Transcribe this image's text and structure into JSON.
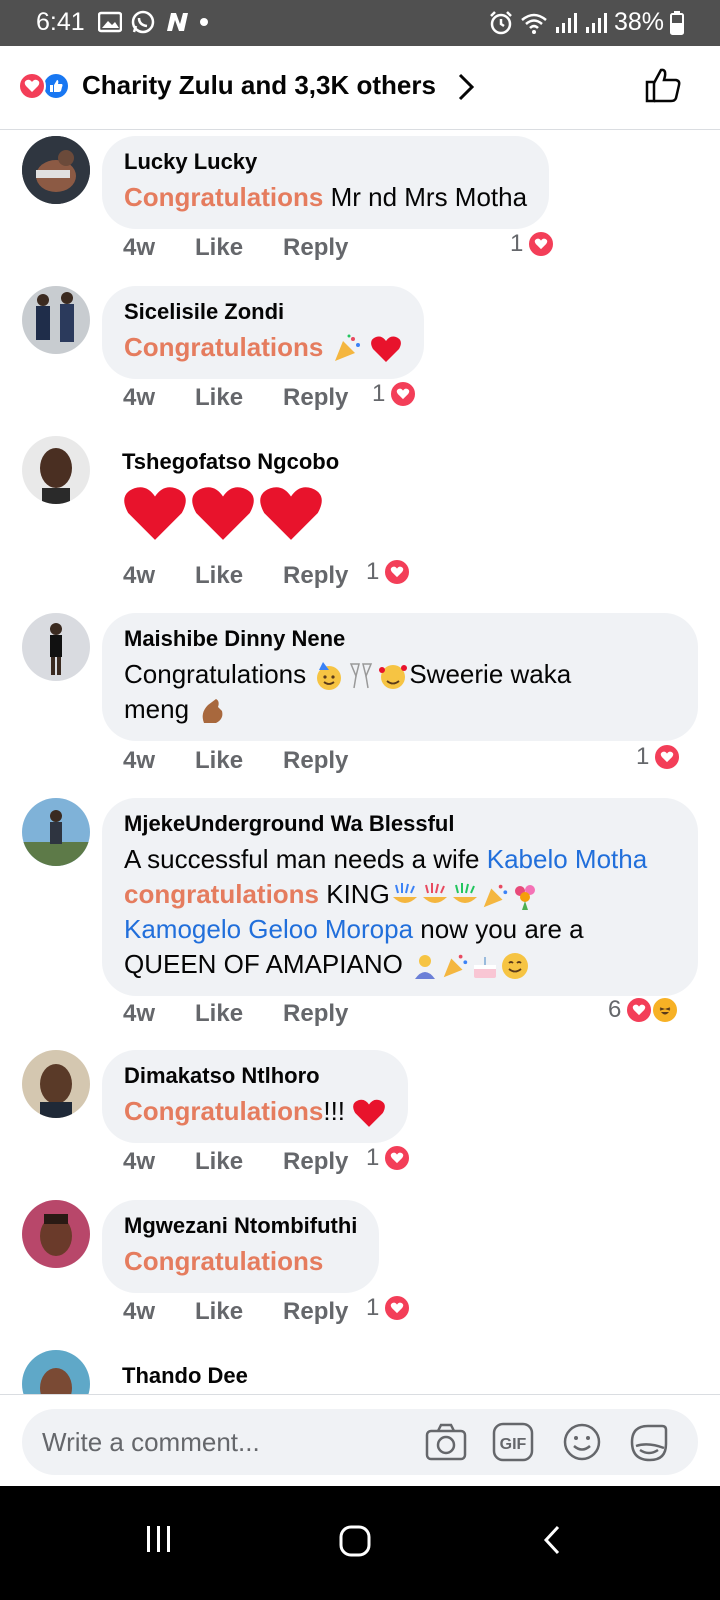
{
  "status_bar": {
    "time": "6:41",
    "battery": "38%"
  },
  "header": {
    "title": "Charity Zulu and 3,3K others"
  },
  "comments": [
    {
      "name": "Lucky Lucky",
      "keyword": "Congratulations",
      "text": " Mr nd Mrs Motha",
      "time": "4w",
      "like": "Like",
      "reply": "Reply",
      "reaction_count": "1"
    },
    {
      "name": "Sicelisile Zondi",
      "keyword": "Congratulations",
      "text": "",
      "time": "4w",
      "like": "Like",
      "reply": "Reply",
      "reaction_count": "1"
    },
    {
      "name": "Tshegofatso Ngcobo",
      "time": "4w",
      "like": "Like",
      "reply": "Reply",
      "reaction_count": "1"
    },
    {
      "name": "Maishibe Dinny Nene",
      "text_a": "Congratulations ",
      "text_b": "Sweerie waka",
      "text_c": "meng ",
      "time": "4w",
      "like": "Like",
      "reply": "Reply",
      "reaction_count": "1"
    },
    {
      "name": "MjekeUnderground Wa Blessful",
      "text_a": "A  successful man needs a wife ",
      "tag_1": "Kabelo Motha",
      "keyword": "congratulations",
      "text_b": " KING",
      "tag_2": "Kamogelo Geloo Moropa",
      "text_c": "  now you are a QUEEN OF AMAPIANO ",
      "time": "4w",
      "like": "Like",
      "reply": "Reply",
      "reaction_count": "6"
    },
    {
      "name": "Dimakatso Ntlhoro",
      "keyword": "Congratulations",
      "text": "!!! ",
      "time": "4w",
      "like": "Like",
      "reply": "Reply",
      "reaction_count": "1"
    },
    {
      "name": "Mgwezani Ntombifuthi",
      "keyword": "Congratulations",
      "time": "4w",
      "like": "Like",
      "reply": "Reply",
      "reaction_count": "1"
    },
    {
      "name": "Thando Dee"
    }
  ],
  "composer": {
    "placeholder": "Write a comment..."
  },
  "icons": [
    "gallery-icon",
    "whatsapp-icon",
    "n-icon",
    "alarm-icon",
    "wifi-icon",
    "signal-icon",
    "battery-icon",
    "love-reaction-icon",
    "like-reaction-icon",
    "chevron-right-icon",
    "thumbs-up-icon",
    "party-popper-icon",
    "heart-icon",
    "camera-icon",
    "gif-icon",
    "emoji-icon",
    "sticker-icon",
    "recents-icon",
    "home-icon",
    "back-icon"
  ],
  "colors": {
    "keyword": "#e57c5e",
    "tag": "#216fdb",
    "love": "#f33e58",
    "like": "#1877f2",
    "bubble": "#f0f2f5",
    "meta": "#65676b"
  }
}
